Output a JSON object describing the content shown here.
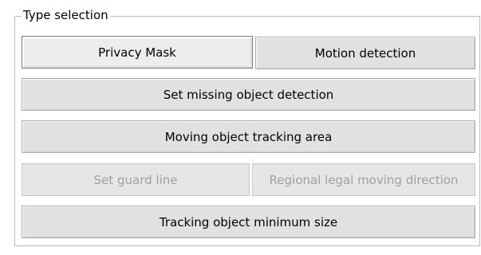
{
  "group": {
    "title": "Type selection"
  },
  "buttons": {
    "privacy_mask": "Privacy Mask",
    "motion_detection": "Motion detection",
    "set_missing_object_detection": "Set missing object detection",
    "moving_object_tracking_area": "Moving object tracking area",
    "set_guard_line": "Set guard line",
    "regional_legal_moving_direction": "Regional legal moving direction",
    "tracking_object_minimum_size": "Tracking object minimum size"
  },
  "state": {
    "selected": "Privacy Mask",
    "disabled": [
      "Set guard line",
      "Regional legal moving direction"
    ]
  }
}
